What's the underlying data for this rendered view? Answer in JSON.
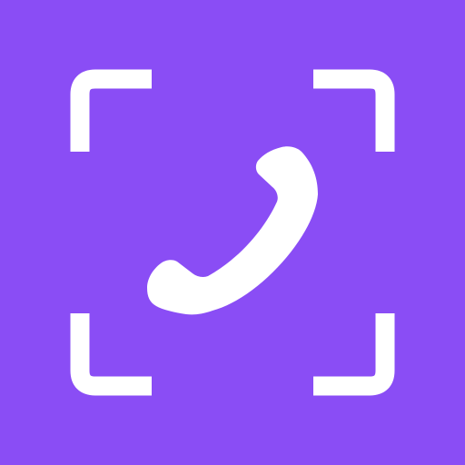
{
  "app_icon": {
    "name": "phone-scan-icon",
    "background_color": "#8A4DF5",
    "foreground_color": "#FFFFFF",
    "elements": [
      "scan-corner-top-left",
      "scan-corner-top-right",
      "scan-corner-bottom-left",
      "scan-corner-bottom-right",
      "phone-handset-icon"
    ]
  }
}
